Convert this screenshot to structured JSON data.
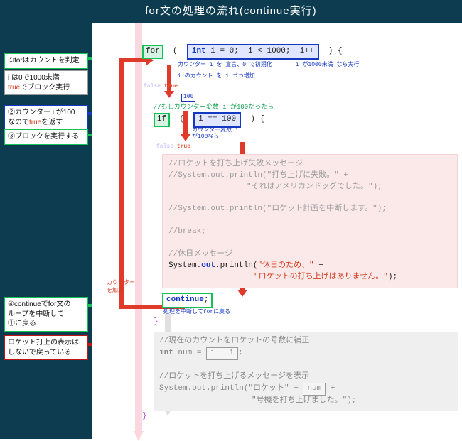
{
  "title": "for文の処理の流れ(continue実行)",
  "labels": {
    "true": "true",
    "false": "false",
    "counterIncr1": "カウンター",
    "counterIncr2": "を加算"
  },
  "callouts": [
    {
      "text": "①forはカウントを判定"
    },
    {
      "line1": "i は0で1000未満",
      "true": "true",
      "line2": "でブロック実行"
    },
    {
      "line1": "②カウンター i が100",
      "line2a": "なので",
      "true": "true",
      "line2b": "を返す"
    },
    {
      "text": "③ブロックを実行する"
    },
    {
      "line1": "④continueでfor文の",
      "line2": "ループを中断して",
      "line3": "①に戻る"
    },
    {
      "line1": "ロケット打上の表示は",
      "line2": "しないで戻っている"
    }
  ],
  "code": {
    "for": {
      "kw": "for",
      "type": "int",
      "init": "i = 0",
      "cond": "i < 1000",
      "step": "i++",
      "note1a": "カウンター i を\n宣言、0 で初期化",
      "note2": "i が1000未満\nなら実行",
      "note3": "i のカウント\nを 1 づつ増加"
    },
    "if": {
      "kw": "if",
      "cond": "i == 100",
      "comment": "//もしカウンター変数 i が100だったら",
      "badge100": "100",
      "note1": "カウンター変数 i",
      "note2": "が100なら"
    },
    "body": {
      "c_fail": "//ロケットを打ち上げ失敗メッセージ",
      "fail1": "\"打ち上げに失敗。\"",
      "fail2": "\"それはアメリカンドッグでした。\");",
      "abort": "\"ロケット計画を中断します。\"",
      "break": "//break;",
      "c_holiday": "//休日メッセージ",
      "h1": "\"休日のため、\"",
      "h2": "\"ロケットの打ち上げはありません。\""
    },
    "cont": {
      "kw": "continue",
      "note": "処理を中断してforに戻る"
    },
    "after": {
      "c_num": "//現在のカウントをロケットの号数に補正",
      "numExpr": "i + 1",
      "c_launch": "//ロケットを打ち上げるメッセージを表示",
      "s1": "\"ロケット\"",
      "var": "num",
      "s2": "\"号機を打ち上げました。\""
    }
  }
}
